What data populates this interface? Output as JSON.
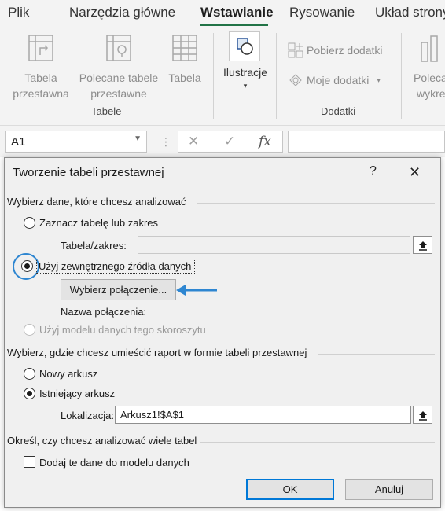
{
  "ribbon": {
    "tabs": [
      "Plik",
      "Narzędzia główne",
      "Wstawianie",
      "Rysowanie",
      "Układ strony"
    ],
    "active_tab": "Wstawianie",
    "groups": {
      "tables": {
        "label": "Tabele",
        "commands": {
          "pivot_line1": "Tabela",
          "pivot_line2": "przestawna",
          "recommended_line1": "Polecane tabele",
          "recommended_line2": "przestawne",
          "table": "Tabela"
        }
      },
      "illustrations": {
        "label": "Ilustracje",
        "dropdown": "▾"
      },
      "addins": {
        "label": "Dodatki",
        "get_addins": "Pobierz dodatki",
        "my_addins": "Moje dodatki"
      },
      "charts": {
        "line1": "Poleca",
        "line2": "wykre"
      }
    },
    "accent_color": "#217346"
  },
  "formula_bar": {
    "name_box": "A1",
    "cancel_symbol": "✕",
    "enter_symbol": "✓",
    "fx_symbol": "fx",
    "value": ""
  },
  "dialog": {
    "title": "Tworzenie tabeli przestawnej",
    "help_symbol": "?",
    "close_symbol": "✕",
    "section_data": "Wybierz dane, które chcesz analizować",
    "option_select_table": "Zaznacz tabelę lub zakres",
    "table_range_label": "Tabela/zakres:",
    "table_range_value": "",
    "option_external": "Użyj zewnętrznego źródła danych",
    "choose_connection_button": "Wybierz połączenie...",
    "connection_name_label": "Nazwa połączenia:",
    "connection_name_value": "",
    "option_data_model": "Użyj modelu danych tego skoroszytu",
    "section_location": "Wybierz, gdzie chcesz umieścić raport w formie tabeli przestawnej",
    "option_new_sheet": "Nowy arkusz",
    "option_existing_sheet": "Istniejący arkusz",
    "location_label": "Lokalizacja:",
    "location_value": "Arkusz1!$A$1",
    "section_multiple": "Określ, czy chcesz analizować wiele tabel",
    "add_to_model_label": "Dodaj te dane do modelu danych",
    "ok_button": "OK",
    "cancel_button": "Anuluj",
    "selected_source": "external",
    "selected_location": "existing",
    "add_to_model_checked": false,
    "annotation_arrow_color": "#2e86d1"
  }
}
